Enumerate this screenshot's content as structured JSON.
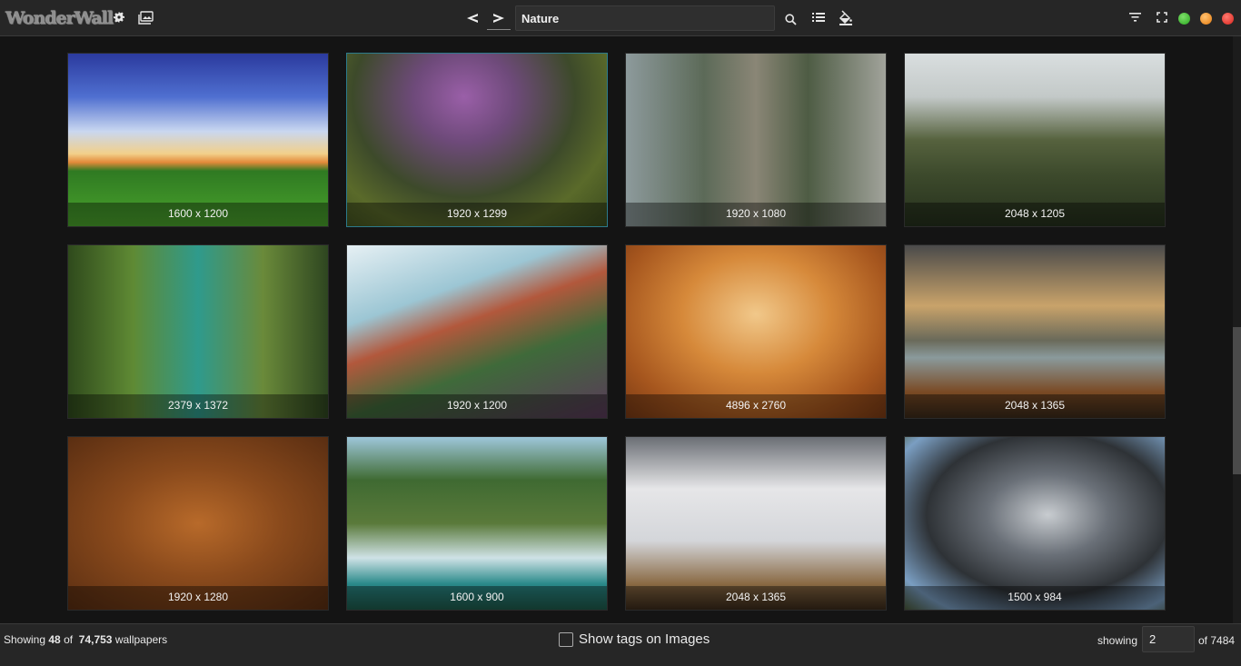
{
  "app": {
    "logo_text": "WonderWall"
  },
  "header": {
    "search_value": "Nature"
  },
  "wallpapers": [
    {
      "resolution": "1600 x 1200"
    },
    {
      "resolution": "1920 x 1299"
    },
    {
      "resolution": "1920 x 1080"
    },
    {
      "resolution": "2048 x 1205"
    },
    {
      "resolution": "2379 x 1372"
    },
    {
      "resolution": "1920 x 1200"
    },
    {
      "resolution": "4896 x 2760"
    },
    {
      "resolution": "2048 x 1365"
    },
    {
      "resolution": "1920 x 1280"
    },
    {
      "resolution": "1600 x 900"
    },
    {
      "resolution": "2048 x 1365"
    },
    {
      "resolution": "1500 x 984"
    }
  ],
  "footer": {
    "showing_prefix": "Showing",
    "shown_count": "48",
    "of_word": "of",
    "total_count": "74,753",
    "total_suffix": "wallpapers",
    "show_tags_label": "Show tags on Images",
    "showing_label": "showing",
    "page_value": "2",
    "page_total_label": "of 7484"
  },
  "colors": {
    "accent_selected": "#2c7a8c",
    "window_green": "#3fbf2f",
    "window_orange": "#f08a1c",
    "window_red": "#e5322b"
  }
}
